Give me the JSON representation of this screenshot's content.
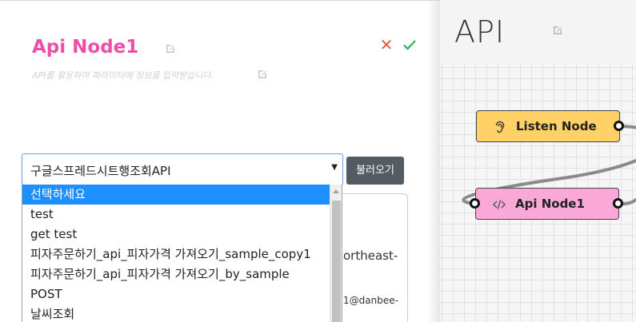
{
  "left": {
    "node_title": "Api Node1",
    "description": "API를 활용하여 파라미터에 정보를 입력받습니다.",
    "close_glyph": "✕",
    "select_value": "구글스프레드시트행조회API",
    "select_arrow": "▼",
    "load_button": "불러오기",
    "dropdown_options": [
      "선택하세요",
      "test",
      "get test",
      "피자주문하기_api_피자가격 가져오기_sample_copy1",
      "피자주문하기_api_피자가격 가져오기_by_sample",
      "POST",
      "날씨조회"
    ],
    "selected_index": 0,
    "behind_text_1": "ortheast-",
    "behind_text_2": "1@danbee-"
  },
  "canvas": {
    "title": "API",
    "nodes": [
      {
        "label": "Listen Node",
        "icon": "ear-icon",
        "color": "#ffd166"
      },
      {
        "label": "Api Node1",
        "icon": "code-icon",
        "color": "#f9a8d8"
      }
    ]
  },
  "colors": {
    "title_pink": "#ee4fa6",
    "close_red": "#e8593a",
    "check_green": "#2bb24c",
    "select_border": "#6a9be8",
    "selected_bg": "#1e8fff",
    "button_dark": "#535b63"
  }
}
